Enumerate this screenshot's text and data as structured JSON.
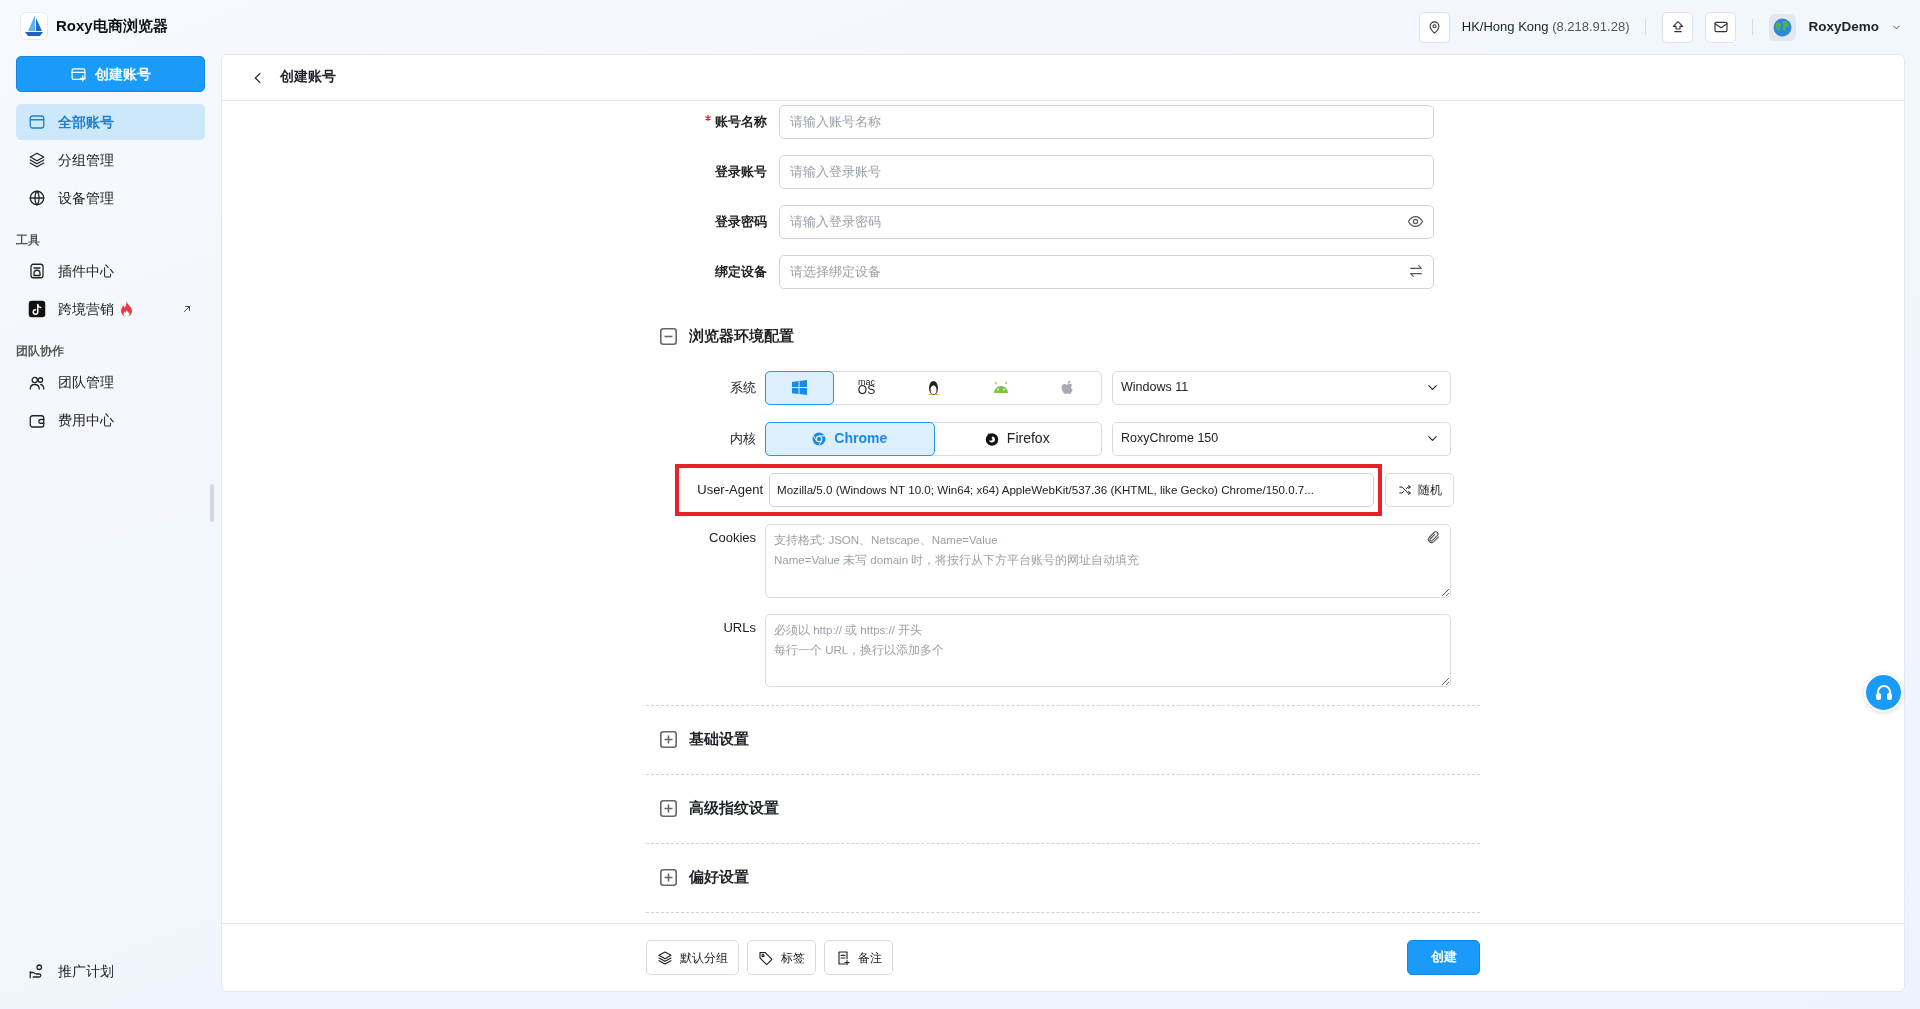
{
  "app": {
    "name": "Roxy电商浏览器"
  },
  "sidebar": {
    "create_button": "创建账号",
    "groups": [
      {
        "items": [
          {
            "label": "全部账号",
            "selected": true,
            "hot": false,
            "external": false
          },
          {
            "label": "分组管理",
            "selected": false,
            "hot": false,
            "external": false
          },
          {
            "label": "设备管理",
            "selected": false,
            "hot": false,
            "external": false
          }
        ]
      },
      {
        "heading": "工具",
        "items": [
          {
            "label": "插件中心",
            "selected": false,
            "hot": false,
            "external": false
          },
          {
            "label": "跨境营销",
            "selected": false,
            "hot": true,
            "external": true
          }
        ]
      },
      {
        "heading": "团队协作",
        "items": [
          {
            "label": "团队管理",
            "selected": false,
            "hot": false,
            "external": false
          },
          {
            "label": "费用中心",
            "selected": false,
            "hot": false,
            "external": false
          }
        ]
      }
    ],
    "footer_item": "推广计划"
  },
  "topbar": {
    "location": "HK/Hong Kong",
    "ip": "(8.218.91.28)",
    "user": "RoxyDemo"
  },
  "page": {
    "title": "创建账号"
  },
  "account_fields": [
    {
      "label": "账号名称",
      "required": true,
      "placeholder": "请输入账号名称",
      "kind": "text"
    },
    {
      "label": "登录账号",
      "required": false,
      "placeholder": "请输入登录账号",
      "kind": "text"
    },
    {
      "label": "登录密码",
      "required": false,
      "placeholder": "请输入登录密码",
      "kind": "password"
    },
    {
      "label": "绑定设备",
      "required": false,
      "placeholder": "请选择绑定设备",
      "kind": "device"
    }
  ],
  "sections": [
    {
      "title": "浏览器环境配置",
      "expanded": true,
      "content": {
        "system_label": "系统",
        "os_options": [
          {
            "kind": "windows",
            "selected": true
          },
          {
            "kind": "macos",
            "text": [
              "mac",
              "OS"
            ],
            "selected": false
          },
          {
            "kind": "linux",
            "selected": false
          },
          {
            "kind": "android",
            "selected": false
          },
          {
            "kind": "ios",
            "selected": false
          }
        ],
        "os_version": "Windows 11",
        "kernel_label": "内核",
        "kernels": [
          {
            "kind": "chrome",
            "label": "Chrome",
            "selected": true
          },
          {
            "kind": "firefox",
            "label": "Firefox",
            "selected": false
          }
        ],
        "kernel_version": "RoxyChrome 150",
        "user_agent": {
          "label": "User-Agent",
          "value": "Mozilla/5.0 (Windows NT 10.0; Win64; x64) AppleWebKit/537.36 (KHTML, like Gecko) Chrome/150.0.7...",
          "highlighted": true
        },
        "random_button": "随机",
        "cookies": {
          "label": "Cookies",
          "placeholder_lines": [
            "支持格式: JSON、Netscape、Name=Value",
            "Name=Value 未写 domain 时，将按行从下方平台账号的网址自动填充"
          ]
        },
        "urls": {
          "label": "URLs",
          "placeholder_lines": [
            "必须以 http:// 或 https:// 开头",
            "每行一个 URL，换行以添加多个"
          ]
        }
      }
    },
    {
      "title": "基础设置",
      "expanded": false
    },
    {
      "title": "高级指纹设置",
      "expanded": false
    },
    {
      "title": "偏好设置",
      "expanded": false
    }
  ],
  "footer": {
    "buttons": [
      {
        "kind": "group",
        "label": "默认分组"
      },
      {
        "kind": "tag",
        "label": "标签"
      },
      {
        "kind": "note",
        "label": "备注"
      }
    ],
    "submit": "创建"
  }
}
